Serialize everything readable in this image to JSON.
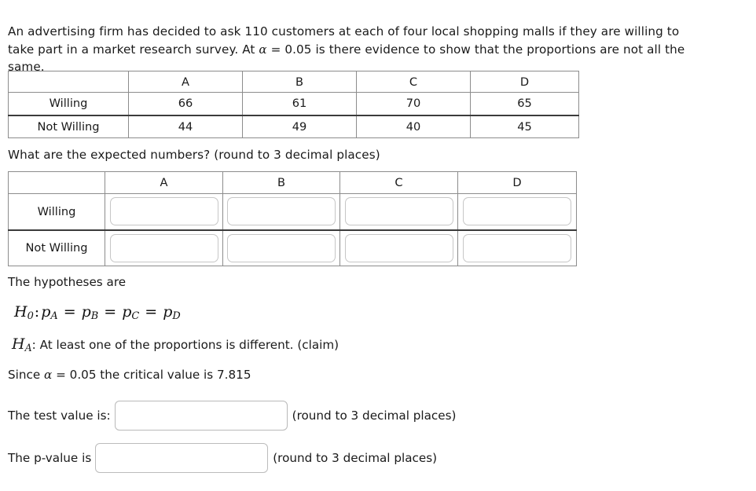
{
  "problem": {
    "statement_part1": "An advertising firm has decided to ask 110 customers at each of four local shopping malls if they are willing to take part in a market research survey. At ",
    "alpha_symbol": "α",
    "statement_part2": " = 0.05 is there evidence to show that the proportions are not all the same."
  },
  "observed_table": {
    "name": "observed-frequencies",
    "corner_label": "",
    "columns": [
      "A",
      "B",
      "C",
      "D"
    ],
    "rows": [
      {
        "label": "Willing",
        "values": [
          "66",
          "61",
          "70",
          "65"
        ]
      },
      {
        "label": "Not Willing",
        "values": [
          "44",
          "49",
          "40",
          "45"
        ]
      }
    ]
  },
  "expected_question": "What are the expected numbers? (round to 3 decimal places)",
  "expected_table": {
    "name": "expected-frequencies",
    "corner_label": "",
    "columns": [
      "A",
      "B",
      "C",
      "D"
    ],
    "rows": [
      {
        "label": "Willing",
        "values": [
          "",
          "",
          "",
          ""
        ]
      },
      {
        "label": "Not Willing",
        "values": [
          "",
          "",
          "",
          ""
        ]
      }
    ]
  },
  "hypotheses": {
    "lead": "The hypotheses are",
    "null": {
      "symbol": "H",
      "symbol_sub": "0",
      "colon": ":",
      "variable": "p",
      "subscripts": [
        "A",
        "B",
        "C",
        "D"
      ],
      "operator": "=",
      "plain_text": "H0: pA = pB = pC = pD"
    },
    "alternative": {
      "symbol": "H",
      "symbol_sub": "A",
      "colon": ":",
      "text": "At least one of the proportions is different. (claim)"
    }
  },
  "critical_value": {
    "prefix": "Since ",
    "alpha_symbol": "α",
    "suffix": " = 0.05 the critical value is 7.815",
    "alpha_level": "0.05",
    "value": "7.815"
  },
  "test_value": {
    "label": "The test value is:",
    "input_value": "",
    "placeholder": "",
    "suffix": "(round to 3 decimal places)"
  },
  "p_value": {
    "label": "The p-value is",
    "input_value": "",
    "placeholder": "",
    "suffix": "(round to 3 decimal places)"
  },
  "colors": {
    "text": "#1a1a1a",
    "table_border": "#8c8c8c",
    "table_heavy_border": "#3b3b3b",
    "input_border": "#c6c6c6",
    "background": "#ffffff"
  }
}
